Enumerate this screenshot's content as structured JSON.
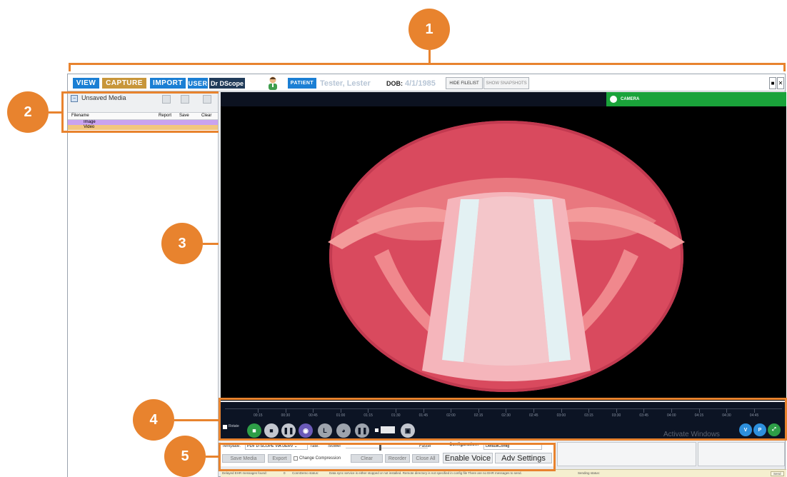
{
  "callouts": [
    "1",
    "2",
    "3",
    "4",
    "5"
  ],
  "toolbar": {
    "view_label": "VIEW",
    "capture_label": "CAPTURE",
    "import_label": "IMPORT",
    "user_label": "USER",
    "user_value": "Dr DScope",
    "patient_label": "PATIENT",
    "patient_name": "Tester, Lester",
    "dob_label": "DOB:",
    "dob_value": "4/1/1985",
    "hide_filelist_label": "HIDE FILELIST",
    "show_snapshots_label": "SHOW SNAPSHOTS"
  },
  "filelist": {
    "title": "Unsaved Media",
    "col_filename": "Filename",
    "col_report": "Report",
    "col_save": "Save",
    "col_clear": "Clear",
    "rows": [
      "Image",
      "Video"
    ]
  },
  "video": {
    "camera_label": "CAMERA"
  },
  "controls": {
    "rotate_label": "Rotate",
    "timeline_ticks": [
      "00:15",
      "00:30",
      "00:45",
      "01:00",
      "01:15",
      "01:30",
      "01:45",
      "02:00",
      "02:15",
      "02:30",
      "02:45",
      "03:00",
      "03:15",
      "03:30",
      "03:45",
      "04:00",
      "04:15",
      "04:30",
      "04:45"
    ],
    "activate_windows": "Activate Windows",
    "v_label": "V",
    "p_label": "P"
  },
  "savepanel": {
    "template_label": "Template:",
    "template_value": "PDF D-SCOPE VIA DERV",
    "rate_label": "rate:",
    "slower_label": "Slower",
    "faster_label": "Faster",
    "configuration_label": "Configuration:",
    "configuration_value": "DefaultConfig",
    "save_media_label": "Save Media",
    "export_label": "Export",
    "change_compression_label": "Change Compression",
    "clear_label": "Clear",
    "reorder_label": "Reorder",
    "close_all_label": "Close All",
    "enable_voice_label": "Enable Voice",
    "adv_settings_label": "Adv Settings"
  },
  "statusbar": {
    "delayed_label": "Delayed EHR messages found:",
    "delayed_count": "0",
    "conndemo_label": "ConnDemo status:",
    "conndemo_text": "Data sync service is either stopped or not installed. Remote directory is not specified in config file There are no EHR messages to send.",
    "sending_label": "Sending status:",
    "send_label": "Send"
  },
  "colors": {
    "accent_orange": "#e8832e",
    "view_blue": "#1b7fd4",
    "capture_gold": "#c8963a",
    "camera_green": "#1aa33a"
  }
}
